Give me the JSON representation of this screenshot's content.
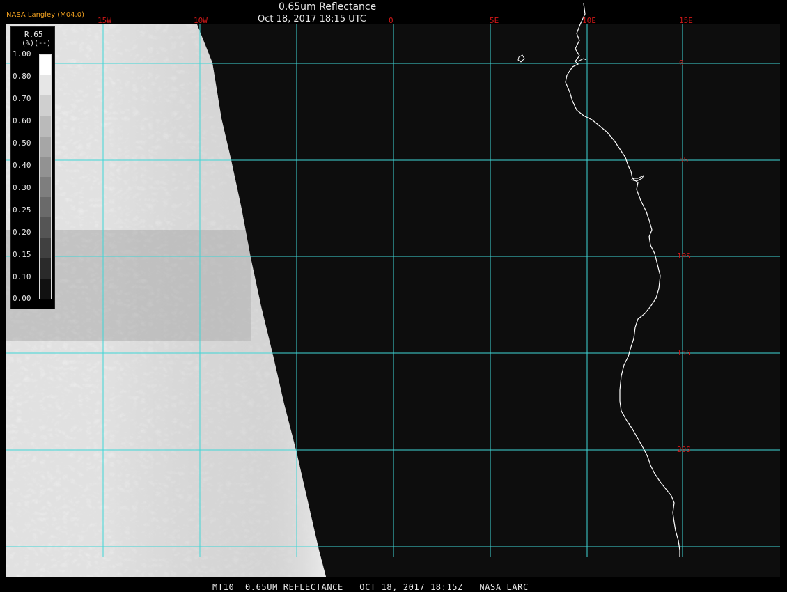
{
  "header": {
    "title": "0.65um Reflectance",
    "timestamp": "Oct 18, 2017 18:15 UTC",
    "credit": "NASA Langley (M04.0)"
  },
  "footer": {
    "caption": "MT10  0.65UM REFLECTANCE   OCT 18, 2017 18:15Z   NASA LARC"
  },
  "map": {
    "longitude_labels": [
      "15W",
      "10W",
      "0",
      "5E",
      "10E",
      "15E"
    ],
    "latitude_labels": [
      "0",
      "5S",
      "10S",
      "15S",
      "20S"
    ],
    "grid_color": "#3fd6d6",
    "label_color": "#d01818",
    "coastline_color": "#ffffff"
  },
  "legend": {
    "title": "R.65",
    "units": "(%)(--)",
    "ticks": [
      "1.00",
      "0.80",
      "0.70",
      "0.60",
      "0.50",
      "0.40",
      "0.30",
      "0.25",
      "0.20",
      "0.15",
      "0.10",
      "0.00"
    ]
  }
}
